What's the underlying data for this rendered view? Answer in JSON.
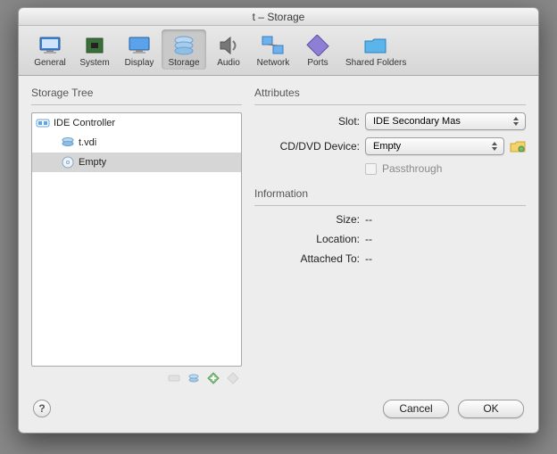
{
  "window": {
    "title": "t – Storage"
  },
  "toolbar": {
    "items": [
      {
        "label": "General"
      },
      {
        "label": "System"
      },
      {
        "label": "Display"
      },
      {
        "label": "Storage"
      },
      {
        "label": "Audio"
      },
      {
        "label": "Network"
      },
      {
        "label": "Ports"
      },
      {
        "label": "Shared Folders"
      }
    ],
    "selected": "Storage"
  },
  "left": {
    "title": "Storage Tree",
    "controller": "IDE Controller",
    "items": [
      {
        "label": "t.vdi"
      },
      {
        "label": "Empty"
      }
    ],
    "selected": "Empty"
  },
  "right": {
    "attributes_title": "Attributes",
    "slot_label": "Slot:",
    "slot_value": "IDE Secondary Mas",
    "device_label": "CD/DVD Device:",
    "device_value": "Empty",
    "passthrough_label": "Passthrough",
    "info_title": "Information",
    "size_label": "Size:",
    "size_value": "--",
    "location_label": "Location:",
    "location_value": "--",
    "attached_label": "Attached To:",
    "attached_value": "--"
  },
  "footer": {
    "cancel": "Cancel",
    "ok": "OK"
  }
}
